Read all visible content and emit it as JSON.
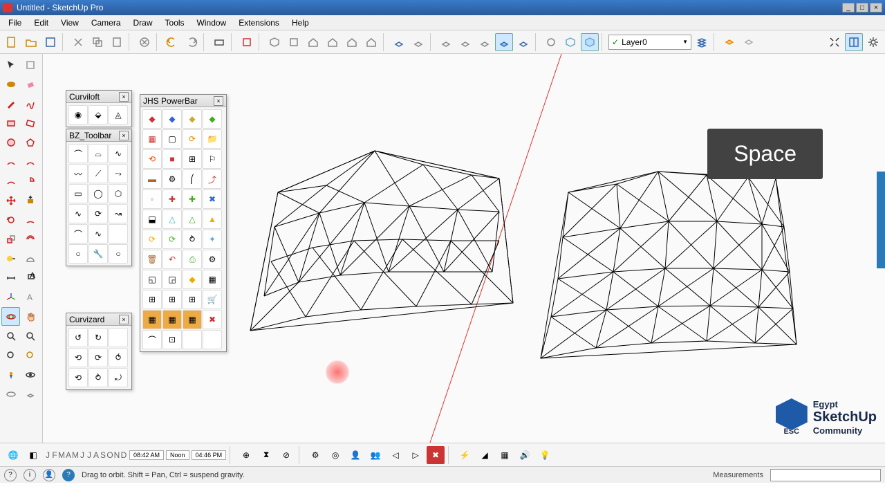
{
  "window": {
    "title": "Untitled - SketchUp Pro"
  },
  "menu": [
    "File",
    "Edit",
    "View",
    "Camera",
    "Draw",
    "Tools",
    "Window",
    "Extensions",
    "Help"
  ],
  "layer": {
    "current": "Layer0"
  },
  "key_overlay": "Space",
  "logo": {
    "line1": "Egypt",
    "line2": "SketchUp",
    "line3": "Community",
    "tag": "ESC"
  },
  "status": {
    "hint": "Drag to orbit. Shift = Pan, Ctrl = suspend gravity.",
    "measurements_label": "Measurements"
  },
  "time": {
    "months": [
      "J",
      "F",
      "M",
      "A",
      "M",
      "J",
      "J",
      "A",
      "S",
      "O",
      "N",
      "D"
    ],
    "t1": "08:42 AM",
    "noon": "Noon",
    "t2": "04:46 PM"
  },
  "panels": {
    "curviloft": {
      "title": "Curviloft",
      "cols": 3,
      "rows": 1
    },
    "bz": {
      "title": "BZ_Toolbar",
      "cols": 3,
      "rows": 7
    },
    "curvizard": {
      "title": "Curvizard",
      "cols": 3,
      "rows": 3
    },
    "jhs": {
      "title": "JHS PowerBar",
      "cols": 4,
      "rows": 12
    }
  },
  "main_icons": [
    "new",
    "open",
    "save",
    "cut",
    "copy",
    "paste",
    "delete",
    "undo",
    "redo",
    "print",
    "model",
    "iso",
    "front",
    "house",
    "top",
    "side",
    "back",
    "xray1",
    "xray2",
    "sect1",
    "sect2",
    "sect3",
    "sect4",
    "sect5",
    "tag1",
    "tag2",
    "tag3"
  ],
  "right_icons": [
    "layers1",
    "layers2",
    "expand",
    "panel",
    "settings"
  ],
  "left_icons": [
    "select",
    "eraser",
    "paint",
    "material",
    "pencil",
    "freehand",
    "rect",
    "rotrect",
    "circle",
    "poly",
    "arc1",
    "arc2",
    "arc3",
    "pie",
    "move",
    "rotate",
    "scale",
    "offset",
    "pushpull",
    "followme",
    "tape",
    "protractor",
    "dim",
    "text",
    "axes",
    "3dtext",
    "orbit",
    "pan",
    "zoom",
    "zoomext",
    "zoomwin",
    "prev",
    "position",
    "walk",
    "look",
    "section"
  ],
  "bottom_icons": [
    "geo",
    "shadow",
    "clock1",
    "clock2",
    "clock3",
    "anim1",
    "anim2",
    "anim3",
    "anim4",
    "anim5",
    "anim6",
    "stop",
    "fog1",
    "fog2",
    "fog3",
    "snd",
    "bulb"
  ]
}
